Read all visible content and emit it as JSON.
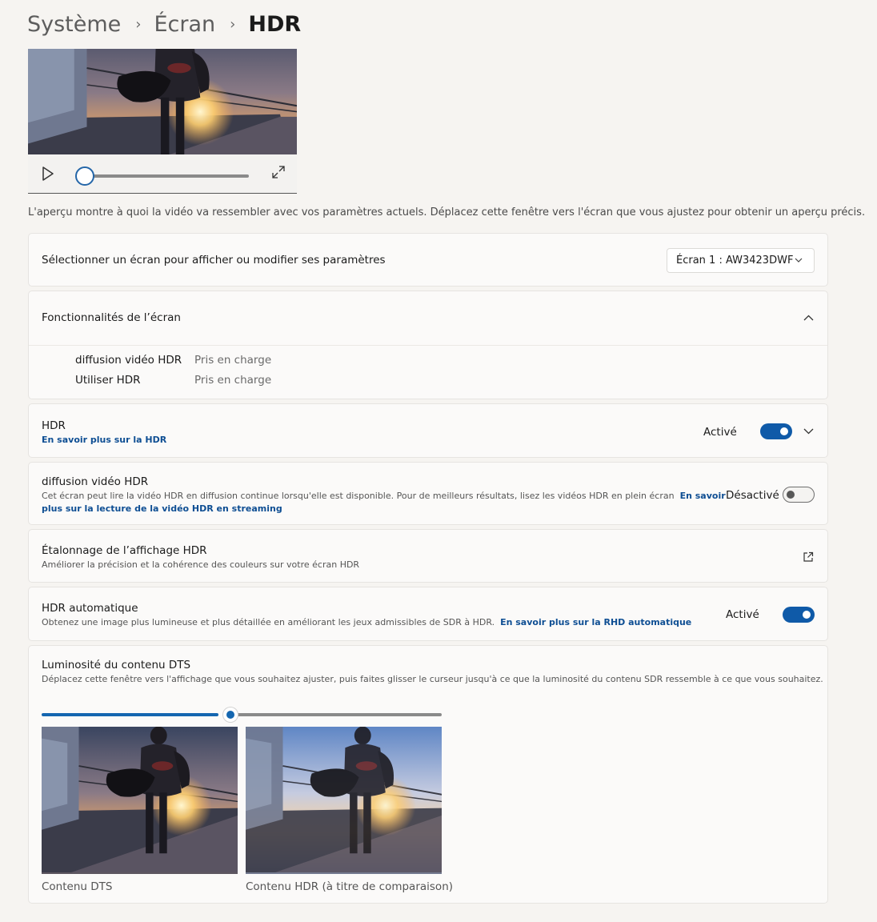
{
  "breadcrumb": {
    "item1": "Système",
    "item2": "Écran",
    "current": "HDR"
  },
  "preview": {
    "description": "L'aperçu montre à quoi la vidéo va ressembler avec vos paramètres actuels. Déplacez cette fenêtre vers l'écran que vous ajustez pour obtenir un aperçu précis.",
    "progress": 0.0
  },
  "display_select": {
    "label": "Sélectionner un écran pour afficher ou modifier ses paramètres",
    "value": "Écran 1 : AW3423DWF"
  },
  "capabilities": {
    "title": "Fonctionnalités de l’écran",
    "rows": [
      {
        "label": "diffusion vidéo HDR",
        "value": "Pris en charge"
      },
      {
        "label": "Utiliser HDR",
        "value": "Pris en charge"
      }
    ]
  },
  "hdr": {
    "title": "HDR",
    "link": "En savoir plus sur la HDR",
    "state": "Activé",
    "on": true
  },
  "streaming": {
    "title": "diffusion vidéo HDR",
    "desc": "Cet écran peut lire la vidéo HDR en diffusion continue lorsqu'elle est disponible. Pour de meilleurs résultats, lisez les vidéos HDR en plein écran",
    "link_part1": "En savoir",
    "link_part2": "plus sur la lecture de la vidéo HDR en streaming",
    "state": "Désactivé",
    "on": false
  },
  "calibration": {
    "title": "Étalonnage de l’affichage HDR",
    "desc": "Améliorer la précision et la cohérence des couleurs sur votre écran HDR"
  },
  "auto_hdr": {
    "title": "HDR automatique",
    "desc": "Obtenez une image plus lumineuse et plus détaillée en améliorant les jeux admissibles de SDR à HDR.",
    "link": "En savoir plus sur la RHD automatique",
    "state": "Activé",
    "on": true
  },
  "sdr_brightness": {
    "title": "Luminosité du contenu DTS",
    "desc": "Déplacez cette fenêtre vers l'affichage que vous souhaitez ajuster, puis faites glisser le curseur jusqu'à ce que la luminosité du contenu SDR ressemble à ce que vous souhaitez.",
    "value": 45,
    "caption_sdr": "Contenu DTS",
    "caption_hdr": "Contenu HDR (à titre de comparaison)"
  },
  "colors": {
    "accent": "#0f5aa8",
    "link": "#0e4e93"
  }
}
